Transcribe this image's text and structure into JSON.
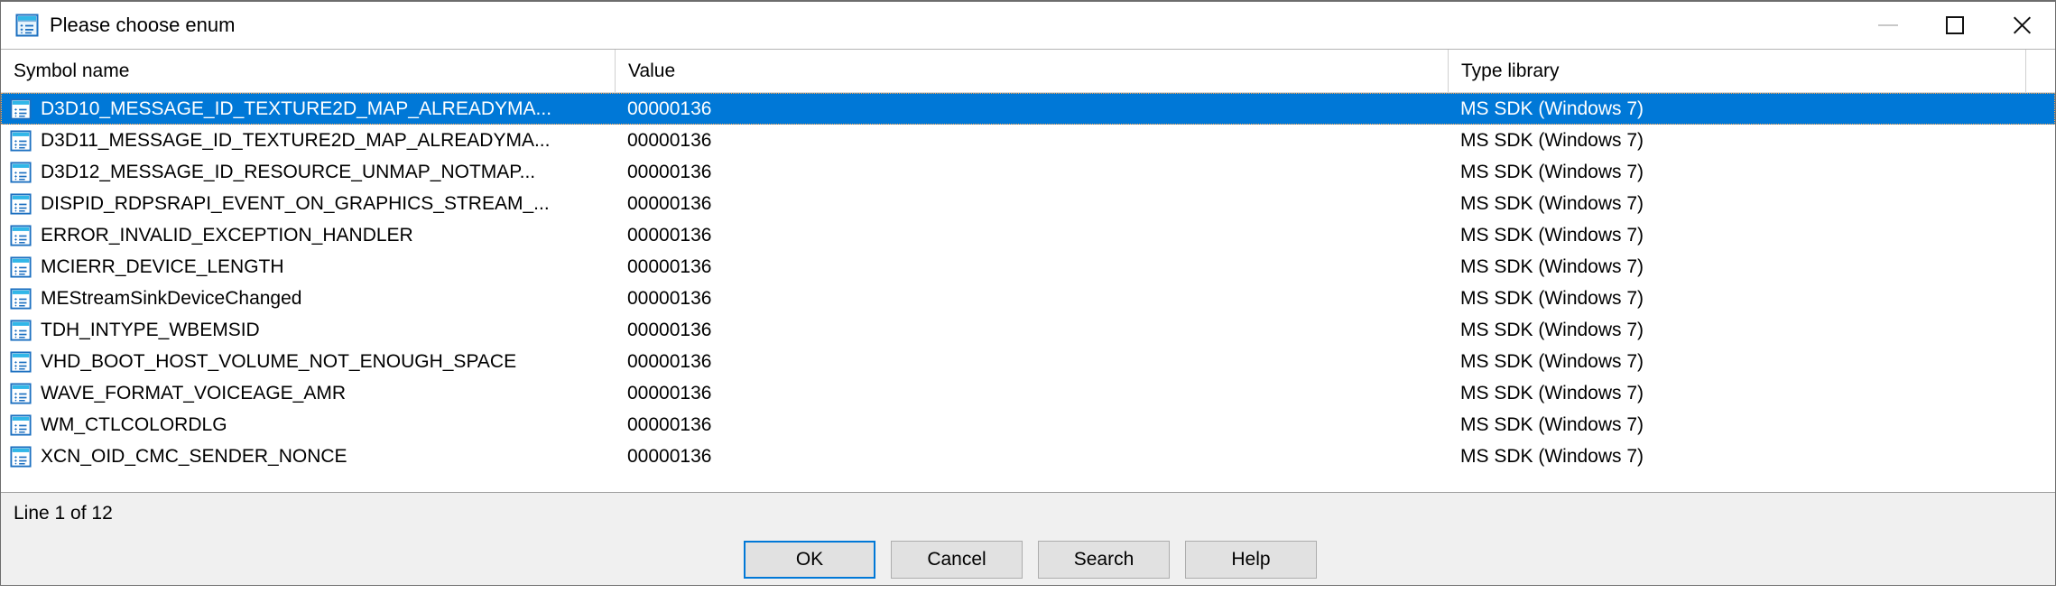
{
  "window": {
    "title": "Please choose enum",
    "icon": "enum-list-icon",
    "controls": {
      "minimize": "minimize-icon",
      "maximize": "maximize-icon",
      "close": "close-icon"
    }
  },
  "list": {
    "columns": [
      {
        "label": "Symbol name"
      },
      {
        "label": "Value"
      },
      {
        "label": "Type library"
      }
    ],
    "rows": [
      {
        "symbol": "D3D10_MESSAGE_ID_TEXTURE2D_MAP_ALREADYMA...",
        "value": "00000136",
        "library": "MS SDK (Windows 7)",
        "selected": true
      },
      {
        "symbol": "D3D11_MESSAGE_ID_TEXTURE2D_MAP_ALREADYMA...",
        "value": "00000136",
        "library": "MS SDK (Windows 7)",
        "selected": false
      },
      {
        "symbol": "D3D12_MESSAGE_ID_RESOURCE_UNMAP_NOTMAP...",
        "value": "00000136",
        "library": "MS SDK (Windows 7)",
        "selected": false
      },
      {
        "symbol": "DISPID_RDPSRAPI_EVENT_ON_GRAPHICS_STREAM_...",
        "value": "00000136",
        "library": "MS SDK (Windows 7)",
        "selected": false
      },
      {
        "symbol": "ERROR_INVALID_EXCEPTION_HANDLER",
        "value": "00000136",
        "library": "MS SDK (Windows 7)",
        "selected": false
      },
      {
        "symbol": "MCIERR_DEVICE_LENGTH",
        "value": "00000136",
        "library": "MS SDK (Windows 7)",
        "selected": false
      },
      {
        "symbol": "MEStreamSinkDeviceChanged",
        "value": "00000136",
        "library": "MS SDK (Windows 7)",
        "selected": false
      },
      {
        "symbol": "TDH_INTYPE_WBEMSID",
        "value": "00000136",
        "library": "MS SDK (Windows 7)",
        "selected": false
      },
      {
        "symbol": "VHD_BOOT_HOST_VOLUME_NOT_ENOUGH_SPACE",
        "value": "00000136",
        "library": "MS SDK (Windows 7)",
        "selected": false
      },
      {
        "symbol": "WAVE_FORMAT_VOICEAGE_AMR",
        "value": "00000136",
        "library": "MS SDK (Windows 7)",
        "selected": false
      },
      {
        "symbol": "WM_CTLCOLORDLG",
        "value": "00000136",
        "library": "MS SDK (Windows 7)",
        "selected": false
      },
      {
        "symbol": "XCN_OID_CMC_SENDER_NONCE",
        "value": "00000136",
        "library": "MS SDK (Windows 7)",
        "selected": false
      }
    ],
    "row_icon": "enum-list-icon"
  },
  "status": {
    "text": "Line 1 of 12"
  },
  "buttons": {
    "ok": "OK",
    "cancel": "Cancel",
    "search": "Search",
    "help": "Help"
  },
  "colors": {
    "selection": "#0078d7",
    "window_border": "#6d6d6d",
    "chrome": "#f0f0f0",
    "button_face": "#e1e1e1"
  }
}
